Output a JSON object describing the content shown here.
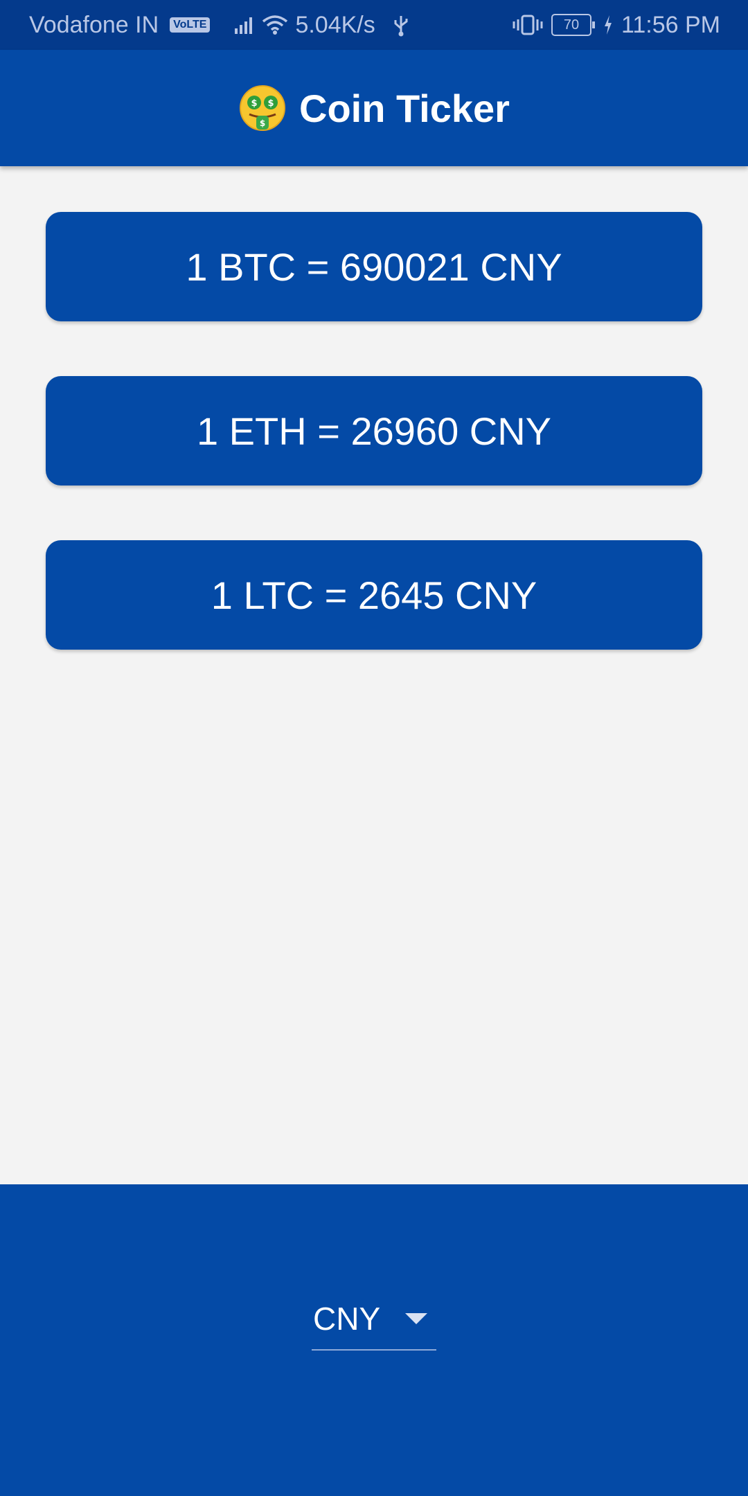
{
  "status_bar": {
    "carrier": "Vodafone IN",
    "volte": "VoLTE",
    "speed": "5.04K/s",
    "battery": "70",
    "time": "11:56 PM"
  },
  "header": {
    "title": "Coin Ticker",
    "icon": "money-mouth-face-icon"
  },
  "rates": [
    {
      "label": "1 BTC = 690021 CNY"
    },
    {
      "label": "1 ETH = 26960 CNY"
    },
    {
      "label": "1 LTC = 2645 CNY"
    }
  ],
  "currency_picker": {
    "selected": "CNY"
  },
  "colors": {
    "primary": "#044aa6",
    "status_bar": "#043a8c",
    "background": "#f3f3f3"
  }
}
